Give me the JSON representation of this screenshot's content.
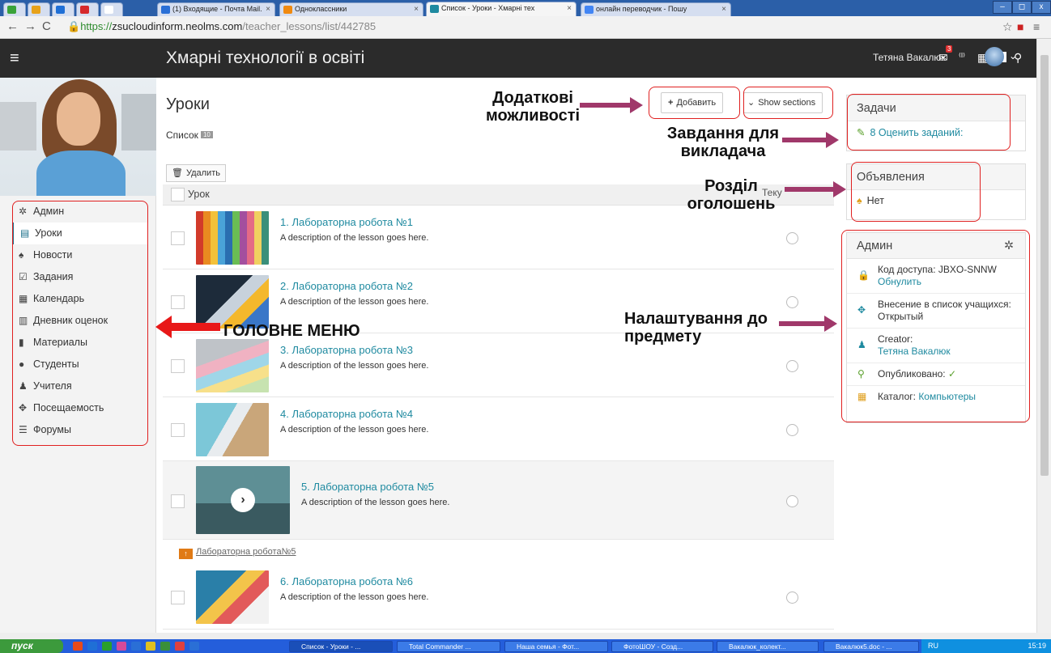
{
  "browser": {
    "tabs": [
      {
        "label": "",
        "color": "#3aa33a"
      },
      {
        "label": "",
        "color": "#e7a21a"
      },
      {
        "label": "",
        "color": "#1f6fd6"
      },
      {
        "label": "",
        "color": "#d6292b"
      },
      {
        "label": "",
        "color": "#ffffff"
      },
      {
        "label": "(1) Входящие - Почта Mail.",
        "color": "#2a6fd6"
      },
      {
        "label": "Одноклассники",
        "color": "#f08a10"
      },
      {
        "label": "Список - Уроки - Хмарні тех",
        "color": "#1f8aa0"
      },
      {
        "label": "онлайн переводчик - Пошу",
        "color": "#4285f4"
      }
    ],
    "url_secure": "https://",
    "url_host": "zsucloudinform.neolms.com",
    "url_path": "/teacher_lessons/list/442785"
  },
  "header": {
    "title": "Хмарні технології в освіті",
    "user": "Тетяна Вакалюк",
    "notif_count": "3"
  },
  "sidebar": {
    "items": [
      {
        "label": "Админ",
        "icon": "gear-icon",
        "glyph": "✲"
      },
      {
        "label": "Уроки",
        "icon": "book-icon",
        "glyph": "▤"
      },
      {
        "label": "Новости",
        "icon": "bell-icon",
        "glyph": "♠"
      },
      {
        "label": "Задания",
        "icon": "check-icon",
        "glyph": "☑"
      },
      {
        "label": "Календарь",
        "icon": "calendar-icon",
        "glyph": "▦"
      },
      {
        "label": "Дневник оценок",
        "icon": "gradebook-icon",
        "glyph": "▥"
      },
      {
        "label": "Материалы",
        "icon": "materials-icon",
        "glyph": "▮"
      },
      {
        "label": "Студенты",
        "icon": "student-icon",
        "glyph": "●"
      },
      {
        "label": "Учителя",
        "icon": "teacher-icon",
        "glyph": "♟"
      },
      {
        "label": "Посещаемость",
        "icon": "attendance-icon",
        "glyph": "✥"
      },
      {
        "label": "Форумы",
        "icon": "forums-icon",
        "glyph": "☰"
      }
    ],
    "selected": 1
  },
  "main": {
    "title": "Уроки",
    "list_tab": "Список",
    "list_count": "10",
    "add_button": "Добавить",
    "show_sections": "Show sections",
    "delete_button": "Удалить",
    "col_lesson": "Урок",
    "col_cut": "Теку",
    "lessons": [
      {
        "title": "1. Лабораторна робота №1",
        "desc": "A description of the lesson goes here."
      },
      {
        "title": "2. Лабораторна робота №2",
        "desc": "A description of the lesson goes here."
      },
      {
        "title": "3. Лабораторна робота №3",
        "desc": "A description of the lesson goes here."
      },
      {
        "title": "4. Лабораторна робота №4",
        "desc": "A description of the lesson goes here."
      },
      {
        "title": "5. Лабораторна робота №5",
        "desc": "A description of the lesson goes here."
      },
      {
        "title": "6. Лабораторна робота №6",
        "desc": "A description of the lesson goes here."
      }
    ],
    "section_link": "Лабораторна робота№5"
  },
  "widgets": {
    "tasks": {
      "title": "Задачи",
      "item": "8 Оценить заданий:"
    },
    "announcements": {
      "title": "Объявления",
      "item": "Нет"
    },
    "admin": {
      "title": "Админ",
      "access_label": "Код доступа: JBXO-SNNW",
      "access_reset": "Обнулить",
      "enroll": "Внесение в список учащихся: Открытый",
      "creator_label": "Creator:",
      "creator_name": "Тетяна Вакалюк",
      "published_label": "Опубликовано:",
      "published_mark": "✓",
      "catalog_label": "Каталог:",
      "catalog_value": "Компьютеры"
    }
  },
  "annotations": {
    "extra": "Додаткові можливості",
    "tasks": "Завдання для викладача",
    "ann_section": "Розділ оголошень",
    "main_menu": "ГОЛОВНЕ МЕНЮ",
    "settings": "Налаштування до предмету"
  },
  "taskbar": {
    "start": "пуск",
    "items": [
      "Список - Уроки - ...",
      "Total Commander ...",
      "Наша семья - Фот...",
      "ФотоШОУ - Созд...",
      "Вакалюк_колект...",
      "Вакалюк5.doc - ..."
    ],
    "lang": "RU",
    "clock": "15:19"
  }
}
